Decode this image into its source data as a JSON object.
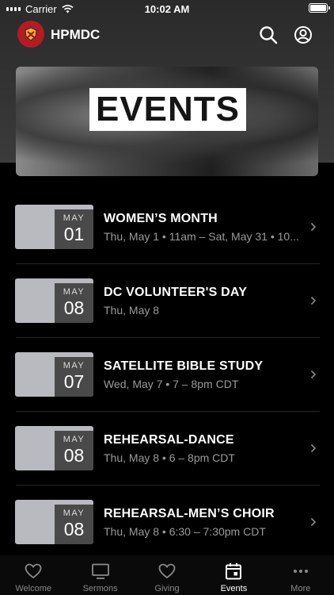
{
  "status_bar": {
    "carrier": "Carrier",
    "time": "10:02 AM"
  },
  "header": {
    "app_name": "HPMDC"
  },
  "banner": {
    "label": "EVENTS"
  },
  "events": [
    {
      "month": "MAY",
      "day": "01",
      "title": "WOMEN’S MONTH",
      "subtitle": "Thu, May 1 • 11am – Sat, May 31 • 10..."
    },
    {
      "month": "MAY",
      "day": "08",
      "title": "DC VOLUNTEER'S DAY",
      "subtitle": "Thu, May 8"
    },
    {
      "month": "MAY",
      "day": "07",
      "title": "SATELLITE BIBLE STUDY",
      "subtitle": "Wed, May 7 • 7 – 8pm CDT"
    },
    {
      "month": "MAY",
      "day": "08",
      "title": "REHEARSAL-DANCE",
      "subtitle": "Thu, May 8 • 6 – 8pm CDT"
    },
    {
      "month": "MAY",
      "day": "08",
      "title": "REHEARSAL-MEN’S CHOIR",
      "subtitle": "Thu, May 8 • 6:30 – 7:30pm CDT"
    }
  ],
  "tabs": [
    {
      "label": "Welcome",
      "icon": "heart-icon"
    },
    {
      "label": "Sermons",
      "icon": "tv-icon"
    },
    {
      "label": "Giving",
      "icon": "heart-icon"
    },
    {
      "label": "Events",
      "icon": "calendar-icon"
    },
    {
      "label": "More",
      "icon": "more-icon"
    }
  ],
  "active_tab": "Events"
}
